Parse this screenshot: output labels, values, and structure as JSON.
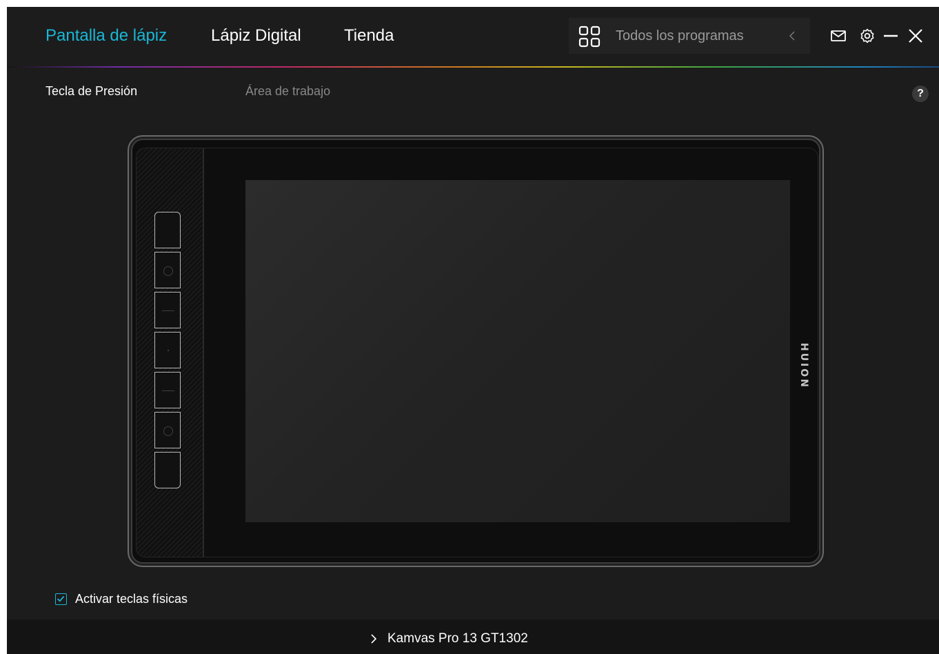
{
  "header": {
    "tabs": [
      {
        "label": "Pantalla de lápiz",
        "active": true
      },
      {
        "label": "Lápiz Digital",
        "active": false
      },
      {
        "label": "Tienda",
        "active": false
      }
    ],
    "program_selector": {
      "label": "Todos los programas",
      "icon": "grid-icon"
    },
    "icons": [
      "mail-icon",
      "gear-icon",
      "minimize-icon",
      "close-icon"
    ]
  },
  "subtabs": [
    {
      "label": "Tecla de Presión",
      "active": true
    },
    {
      "label": "Área de trabajo",
      "active": false
    }
  ],
  "help": {
    "label": "?"
  },
  "tablet": {
    "brand": "HUION",
    "express_keys": 7
  },
  "checkbox": {
    "label": "Activar teclas físicas",
    "checked": true
  },
  "footer": {
    "device": "Kamvas Pro 13 GT1302"
  },
  "colors": {
    "accent": "#19b7d6",
    "background": "#1c1c1c",
    "footer": "#141414"
  }
}
